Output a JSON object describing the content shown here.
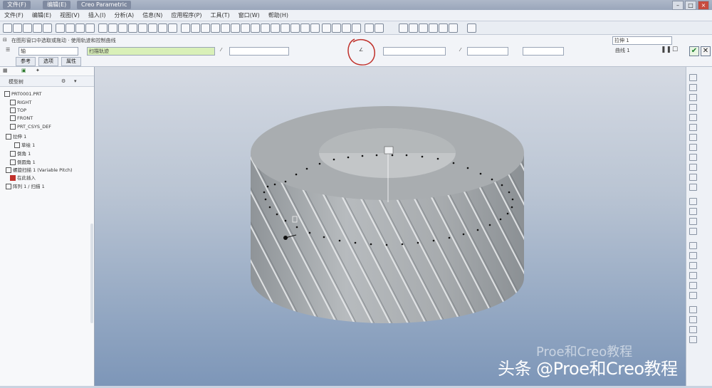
{
  "titlebar": {
    "tabs": [
      "文件(F)",
      "编辑(E)",
      "Creo Parametric"
    ]
  },
  "menubar": {
    "items": [
      "文件(F)",
      "编辑(E)",
      "视图(V)",
      "插入(I)",
      "分析(A)",
      "信息(N)",
      "应用程序(P)",
      "工具(T)",
      "窗口(W)",
      "帮助(H)"
    ]
  },
  "dashboard": {
    "hint_text": "在图形窗口中选取或拖动 · 使用轨迹和控制曲线",
    "row2_dropdown": "轴",
    "row2_green_field": "扫描轨迹",
    "row2_right_label": "曲线 1",
    "tabs": [
      "参考",
      "选项",
      "属性"
    ]
  },
  "leftpanel": {
    "title": "模型树",
    "items": [
      "PRT0001.PRT",
      "RIGHT",
      "TOP",
      "FRONT",
      "PRT_CSYS_DEF",
      "拉伸 1",
      "草绘 1",
      "倒角 1",
      "倒圆角 1",
      "螺旋扫描 1 (Variable Pitch)",
      "在此插入",
      "阵列 1 / 扫描 1"
    ]
  },
  "watermark": {
    "text": "头条 @Proe和Creo教程",
    "ghost": "Proe和Creo教程"
  },
  "colors": {
    "viewport_top": "#d5dae3",
    "viewport_bottom": "#7d96b8",
    "part_gray": "#a9adb0",
    "annotation_red": "#c0312b",
    "confirm_green": "#1b7d2a"
  },
  "icons": [
    "part-model-icon",
    "check-icon",
    "close-icon",
    "helix-sweep-icon",
    "settings-icon",
    "filter-icon",
    "pause-icon"
  ]
}
